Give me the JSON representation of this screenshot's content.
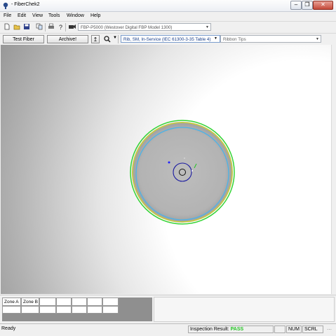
{
  "window": {
    "title": "- FiberChek2",
    "buttons": [
      "minimize",
      "maximize",
      "close"
    ]
  },
  "menu": [
    "File",
    "Edit",
    "View",
    "Tools",
    "Window",
    "Help"
  ],
  "toolbar": {
    "device_combo": "FBP-P5000 (Westover Digital FBP Model 1300)"
  },
  "toolbar2": {
    "test_fiber_label": "Test Fiber",
    "archive_label": "Archive!",
    "profile_combo": "Rib, SM, In-Service (IEC 61300-3-35 Table 4)",
    "tip_combo": "Ribbon Tips"
  },
  "zones": {
    "headers": [
      "Zone A",
      "Zone B",
      "",
      "",
      "",
      "",
      ""
    ]
  },
  "status": {
    "ready": "Ready",
    "inspection_label": "Inspection Result:",
    "inspection_value": "PASS",
    "num": "NUM",
    "scrl": "SCRL"
  },
  "colors": {
    "pass": "#22c322",
    "fiber_outer": "#33d433",
    "fiber_yellow": "#d8d820",
    "fiber_cyan": "#4bb3e8",
    "core_ring": "#1a1aa0",
    "close_button": "#c44a3a"
  },
  "icons": [
    "app-icon",
    "new-icon",
    "open-icon",
    "save-icon",
    "copy-icon",
    "print-icon",
    "help-icon",
    "device-icon",
    "upload-icon",
    "search-icon"
  ]
}
